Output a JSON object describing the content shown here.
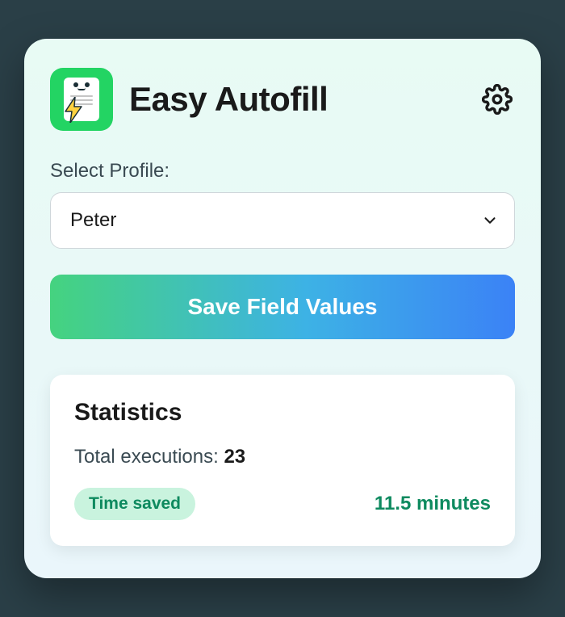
{
  "header": {
    "title": "Easy Autofill"
  },
  "profile": {
    "label": "Select Profile:",
    "selected": "Peter"
  },
  "actions": {
    "save_label": "Save Field Values"
  },
  "stats": {
    "title": "Statistics",
    "executions_label": "Total executions: ",
    "executions_count": "23",
    "time_saved_label": "Time saved",
    "time_saved_value": "11.5 minutes"
  }
}
